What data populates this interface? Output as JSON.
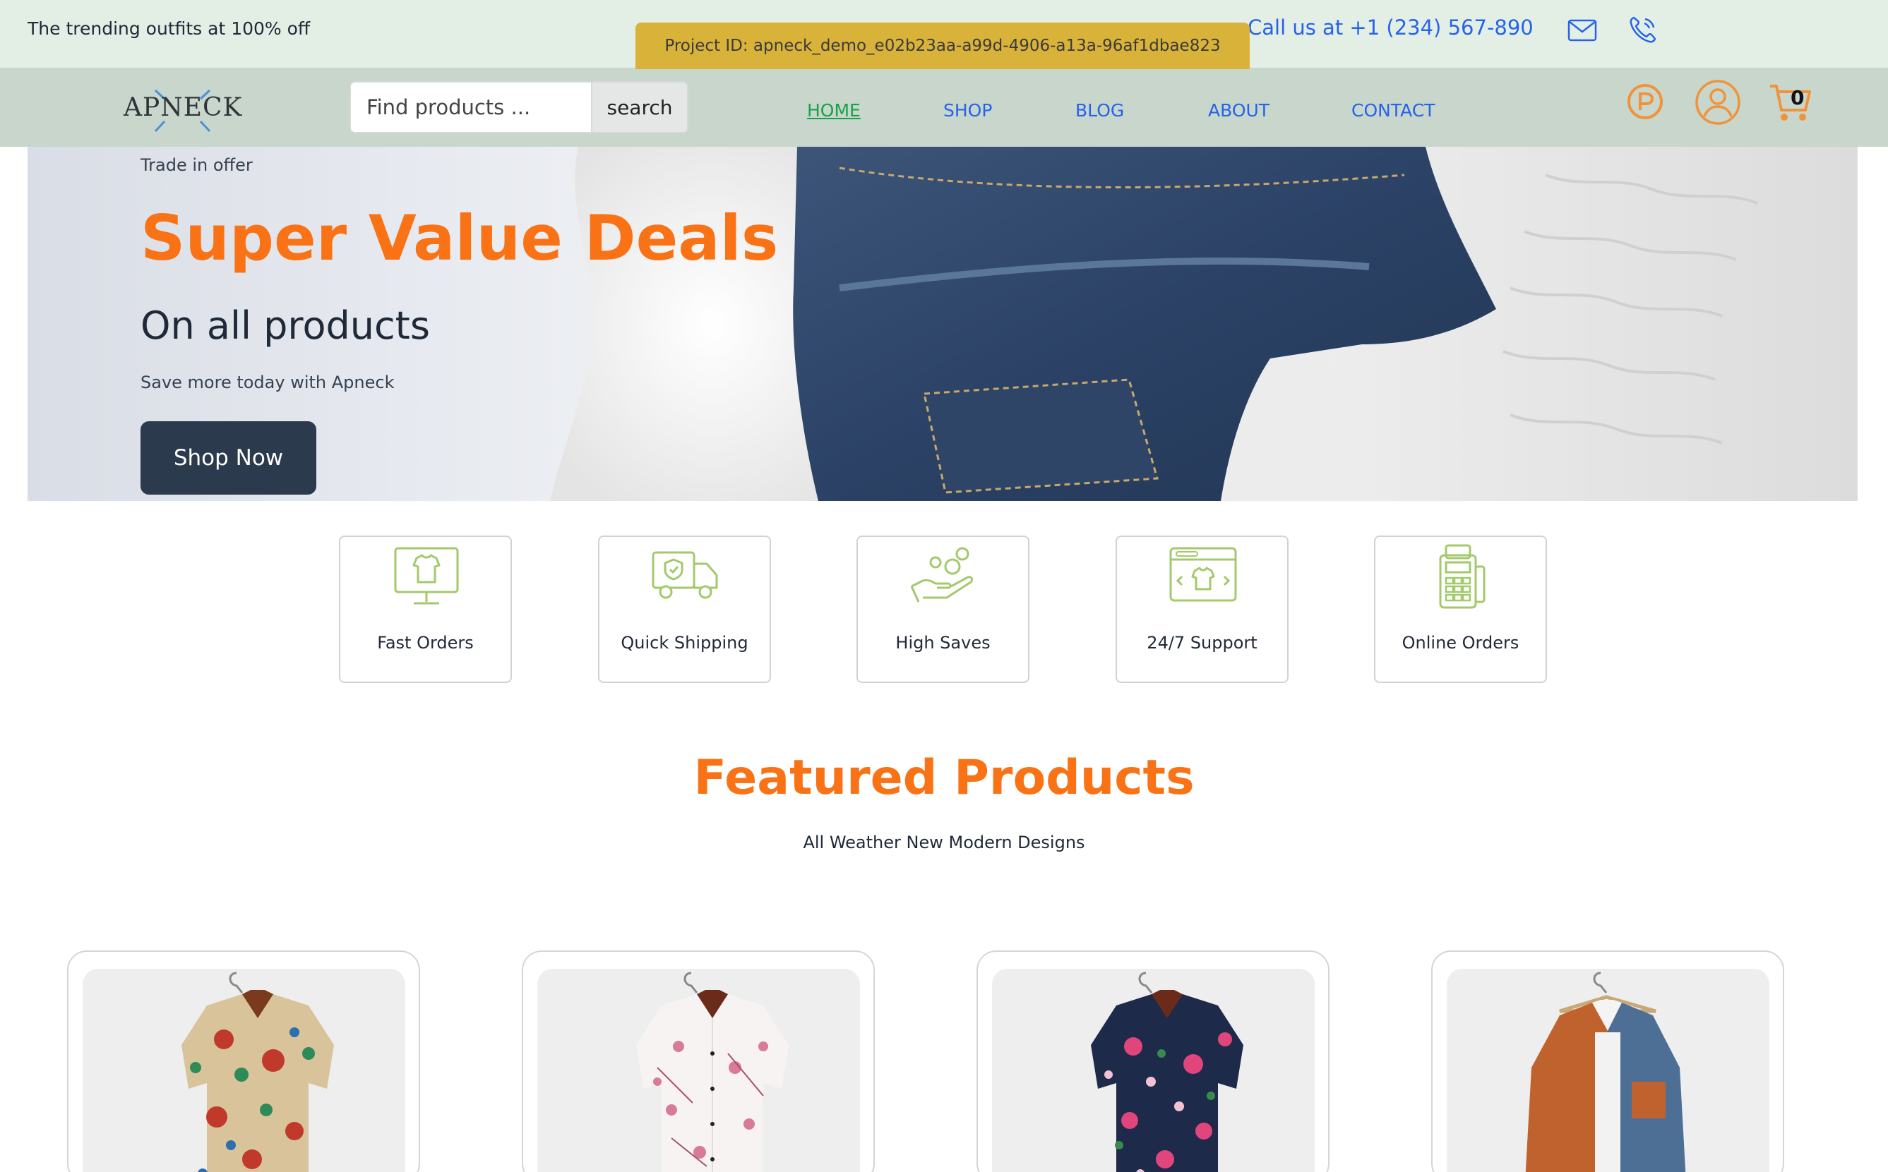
{
  "topbar": {
    "promo_text": "The trending outfits at 100% off",
    "project_id": "Project ID: apneck_demo_e02b23aa-a99d-4906-a13a-96af1dbae823",
    "call_text": "Call us at +1 (234) 567-890",
    "icons": [
      "mail-icon",
      "phone-icon"
    ]
  },
  "nav": {
    "logo_text": "APNECK",
    "search_placeholder": "Find products ...",
    "search_button": "search",
    "links": [
      "HOME",
      "SHOP",
      "BLOG",
      "ABOUT",
      "CONTACT"
    ],
    "active_link": "HOME",
    "cart_count": "0",
    "icons": [
      "points-icon",
      "user-icon",
      "cart-icon"
    ]
  },
  "hero": {
    "tag": "Trade in offer",
    "headline": "Super Value Deals",
    "subheadline": "On all products",
    "save_text": "Save more today with Apneck",
    "cta": "Shop Now"
  },
  "features": [
    {
      "label": "Fast Orders",
      "icon": "monitor-shirt-icon"
    },
    {
      "label": "Quick Shipping",
      "icon": "delivery-truck-icon"
    },
    {
      "label": "High Saves",
      "icon": "hand-coins-icon"
    },
    {
      "label": "24/7 Support",
      "icon": "browser-shirt-icon"
    },
    {
      "label": "Online Orders",
      "icon": "pos-terminal-icon"
    }
  ],
  "featured": {
    "title": "Featured Products",
    "subtitle": "All Weather New Modern Designs"
  },
  "colors": {
    "accent": "#f97316",
    "link": "#2563eb",
    "active_link": "#16a34a",
    "topbar_bg": "#e3eee5",
    "navbar_bg": "#c8d6cb",
    "button_dark": "#2b3a4d",
    "feature_icon": "#a3c96b"
  }
}
